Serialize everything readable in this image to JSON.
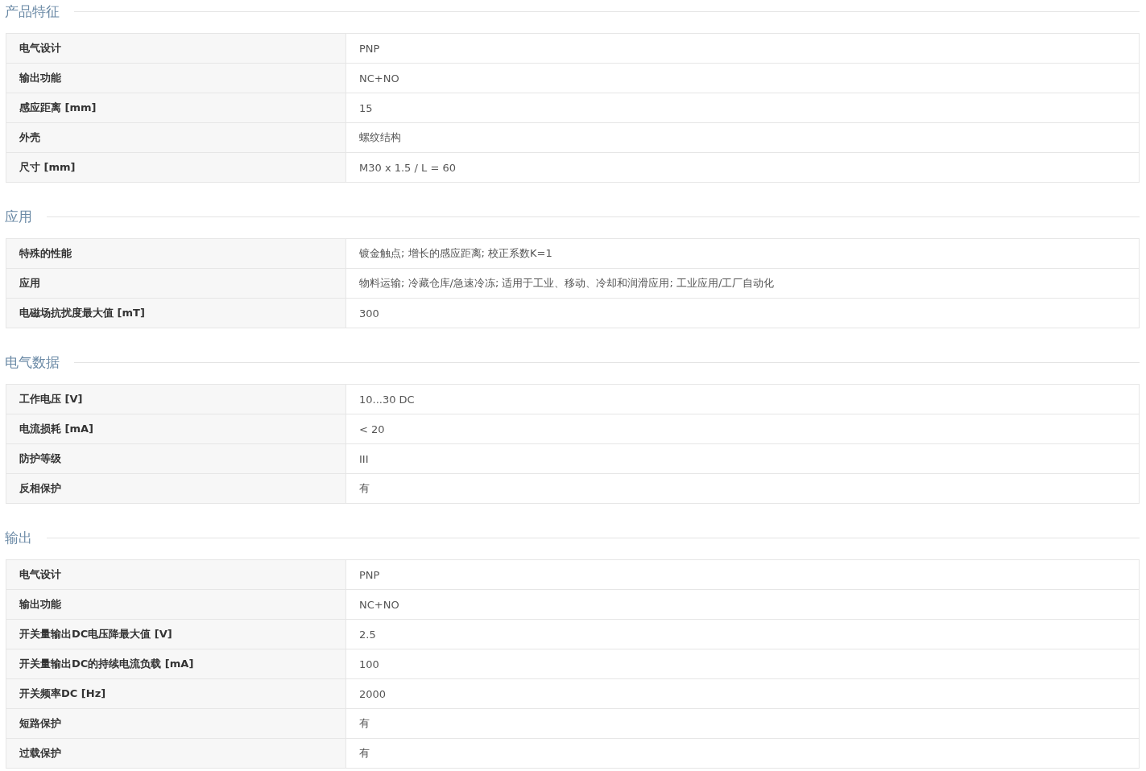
{
  "sections": [
    {
      "title": "产品特征",
      "rows": [
        {
          "label": "电气设计",
          "value": "PNP"
        },
        {
          "label": "输出功能",
          "value": "NC+NO"
        },
        {
          "label": "感应距离 [mm]",
          "value": "15"
        },
        {
          "label": "外壳",
          "value": "螺纹结构"
        },
        {
          "label": "尺寸 [mm]",
          "value": "M30 x 1.5 / L = 60"
        }
      ]
    },
    {
      "title": "应用",
      "rows": [
        {
          "label": "特殊的性能",
          "value": "镀金触点; 增长的感应距离; 校正系数K=1"
        },
        {
          "label": "应用",
          "value": "物料运输; 冷藏仓库/急速冷冻; 适用于工业、移动、冷却和润滑应用; 工业应用/工厂自动化"
        },
        {
          "label": "电磁场抗扰度最大值 [mT]",
          "value": "300"
        }
      ]
    },
    {
      "title": "电气数据",
      "rows": [
        {
          "label": "工作电压 [V]",
          "value": "10...30 DC"
        },
        {
          "label": "电流损耗 [mA]",
          "value": "< 20"
        },
        {
          "label": "防护等级",
          "value": "III"
        },
        {
          "label": "反相保护",
          "value": "有"
        }
      ]
    },
    {
      "title": "输出",
      "rows": [
        {
          "label": "电气设计",
          "value": "PNP"
        },
        {
          "label": "输出功能",
          "value": "NC+NO"
        },
        {
          "label": "开关量输出DC电压降最大值 [V]",
          "value": "2.5"
        },
        {
          "label": "开关量输出DC的持续电流负载 [mA]",
          "value": "100"
        },
        {
          "label": "开关频率DC [Hz]",
          "value": "2000"
        },
        {
          "label": "短路保护",
          "value": "有"
        },
        {
          "label": "过载保护",
          "value": "有"
        }
      ]
    }
  ]
}
